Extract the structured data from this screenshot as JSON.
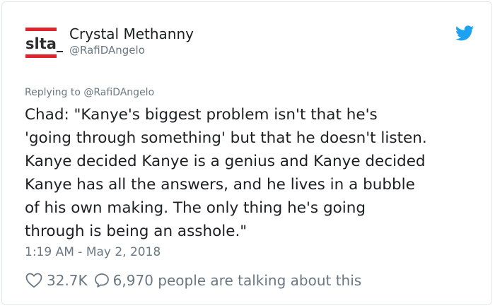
{
  "author": {
    "avatar_text": "slta_",
    "display_name": "Crystal Methanny",
    "handle": "@RafiDAngelo"
  },
  "reply": {
    "label": "Replying to @RafiDAngelo"
  },
  "tweet": {
    "lines": [
      "Chad: \"Kanye's biggest problem isn't that he's",
      "'going through something' but that he doesn't listen.",
      "Kanye decided Kanye is a genius and Kanye decided",
      "Kanye has all the answers, and he lives in a bubble",
      "of his own making. The only thing he's going",
      "through is being an asshole.\""
    ],
    "timestamp": "1:19 AM - May 2, 2018"
  },
  "actions": {
    "like_count": "32.7K",
    "talking_label": "6,970 people are talking about this"
  },
  "icons": {
    "brand": "twitter-bird-icon",
    "like": "heart-icon",
    "reply": "speech-bubble-icon"
  },
  "colors": {
    "twitter_blue": "#1da1f2",
    "secondary_text": "#697882",
    "avatar_red": "#e0242d",
    "avatar_text": "#2d2d2d"
  }
}
